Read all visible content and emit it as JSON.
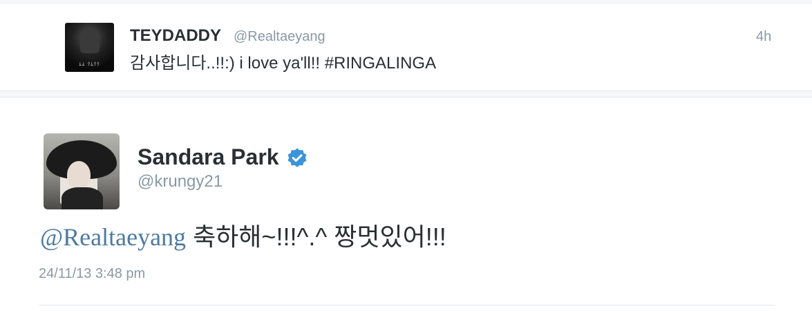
{
  "tweets": [
    {
      "name": "TEYDADDY",
      "handle": "@Realtaeyang",
      "time": "4h",
      "text": "감사합니다..!!:) i love ya'll!! #RINGALINGA",
      "avatar_caption": "ﾑﾑ ｸﾑｸｸ"
    },
    {
      "name": "Sandara Park",
      "verified": true,
      "handle": "@krungy21",
      "mention": "@Realtaeyang",
      "text": " 축하해~!!!^.^ 짱멋있어!!!",
      "timestamp": "24/11/13 3:48 pm"
    }
  ],
  "colors": {
    "verified": "#3b94d9",
    "mention": "#4d7a9f",
    "secondary_text": "#8899a6",
    "primary_text": "#292f33"
  }
}
